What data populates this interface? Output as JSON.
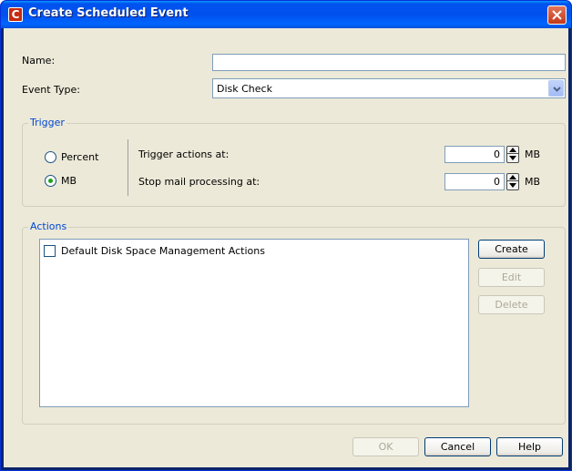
{
  "window": {
    "title": "Create Scheduled Event",
    "app_icon_letter": "C"
  },
  "form": {
    "name_label": "Name:",
    "name_value": "",
    "event_type_label": "Event Type:",
    "event_type_value": "Disk Check"
  },
  "trigger": {
    "legend": "Trigger",
    "percent_label": "Percent",
    "mb_label": "MB",
    "selected_unit": "MB",
    "trigger_actions_label": "Trigger actions at:",
    "trigger_actions_value": "0",
    "trigger_actions_unit": "MB",
    "stop_mail_label": "Stop mail processing at:",
    "stop_mail_value": "0",
    "stop_mail_unit": "MB"
  },
  "actions": {
    "legend": "Actions",
    "items": [
      {
        "label": "Default Disk Space Management Actions",
        "checked": false
      }
    ],
    "create_label": "Create",
    "edit_label": "Edit",
    "delete_label": "Delete"
  },
  "footer": {
    "ok_label": "OK",
    "cancel_label": "Cancel",
    "help_label": "Help"
  }
}
